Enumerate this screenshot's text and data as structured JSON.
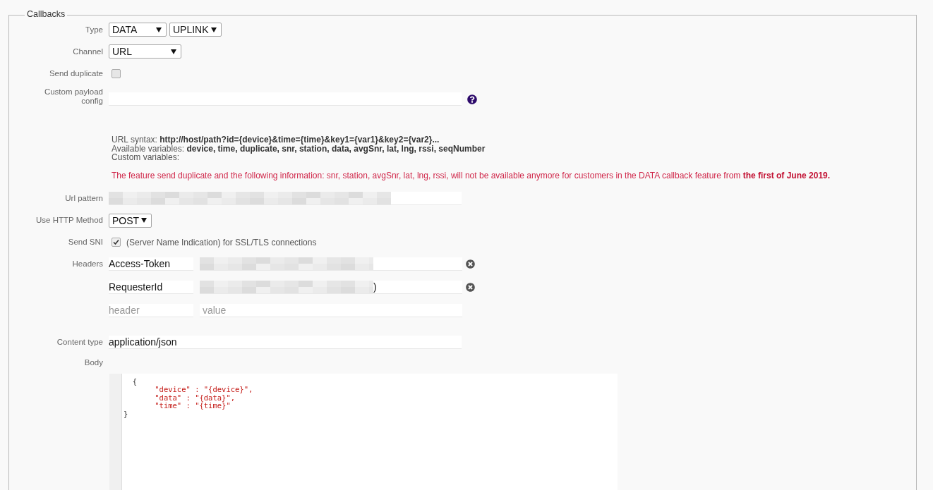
{
  "legend": "Callbacks",
  "type": {
    "label": "Type",
    "selects": [
      {
        "value": "DATA",
        "wide": true
      },
      {
        "value": "UPLINK",
        "wide": false
      }
    ]
  },
  "channel": {
    "label": "Channel",
    "value": "URL"
  },
  "send_duplicate": {
    "label": "Send duplicate",
    "checked": false
  },
  "custom_payload": {
    "label": "Custom payload config"
  },
  "help": [
    "URL syntax: **http://host/path?id={device}&time={time}&key1={var1}&key2={var2}...**",
    "Available variables: **device, time, duplicate, snr, station, data, avgSnr, lat, lng, rssi, seqNumber**",
    "Custom variables:"
  ],
  "warning": "The feature send duplicate and the following information: snr, station, avgSnr, lat, lng, rssi, will not be available anymore for customers in the DATA callback feature from **the first of June 2019.**",
  "url_pattern": {
    "label": "Url pattern"
  },
  "http_method": {
    "label": "Use HTTP Method",
    "value": "POST"
  },
  "send_sni": {
    "label": "Send SNI",
    "checked": true,
    "text": "(Server Name Indication) for SSL/TLS connections"
  },
  "headers": {
    "label": "Headers",
    "rows": [
      {
        "name": "Access-Token",
        "redacted": true,
        "tail": ""
      },
      {
        "name": "RequesterId",
        "redacted": true,
        "tail": ")"
      }
    ],
    "new_row": {
      "name_placeholder": "header",
      "value_placeholder": "value"
    }
  },
  "content_type": {
    "label": "Content type",
    "value": "application/json"
  },
  "body": {
    "label": "Body",
    "lines": [
      {
        "kind": "brace",
        "text": "  {"
      },
      {
        "kind": "entry",
        "text": "       \"device\" : \"{device}\","
      },
      {
        "kind": "entry",
        "text": "       \"data\" : \"{data}\","
      },
      {
        "kind": "entry",
        "text": "       \"time\" : \"{time}\""
      },
      {
        "kind": "brace",
        "text": "}"
      }
    ]
  }
}
